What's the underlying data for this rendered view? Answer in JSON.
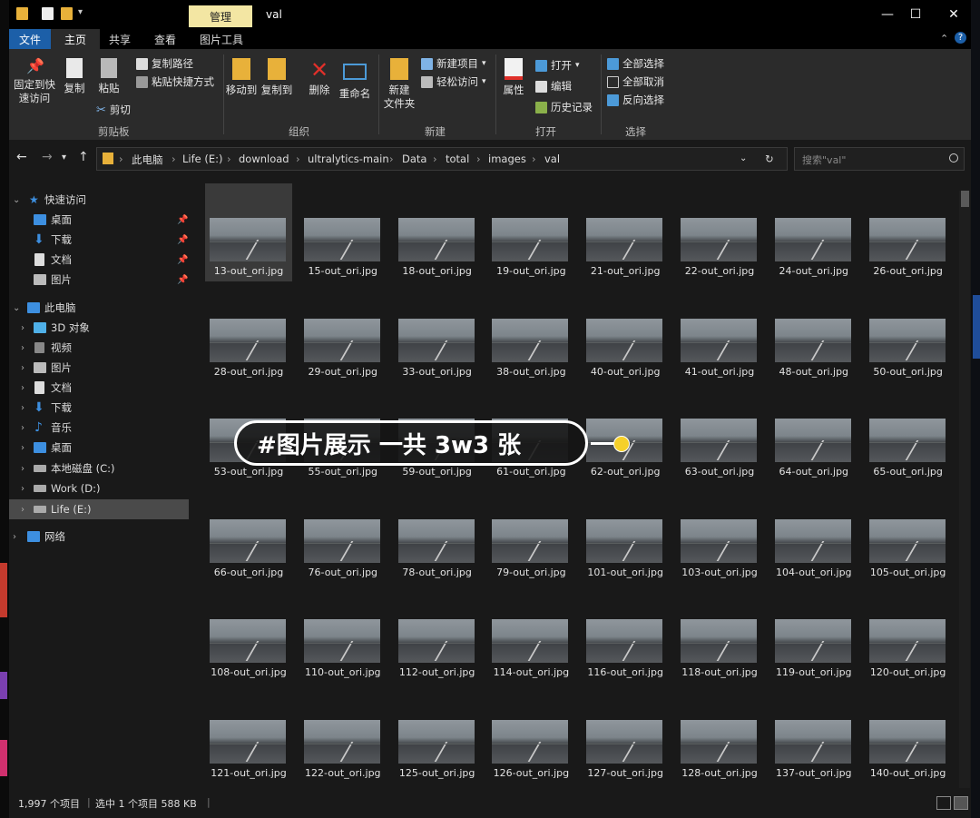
{
  "window": {
    "title": "val",
    "context_tab": "管理",
    "controls": {
      "minimize": "—",
      "maximize": "☐",
      "close": "✕"
    }
  },
  "ribbon_tabs": [
    "文件",
    "主页",
    "共享",
    "查看",
    "图片工具"
  ],
  "ribbon": {
    "clipboard": {
      "pin_quick_access": [
        "固定到快",
        "速访问"
      ],
      "copy": "复制",
      "paste": "粘贴",
      "copy_path": "复制路径",
      "paste_shortcut": "粘贴快捷方式",
      "cut": "剪切",
      "group_label": "剪贴板"
    },
    "organize": {
      "move_to": "移动到",
      "copy_to": "复制到",
      "delete": "删除",
      "rename": "重命名",
      "group_label": "组织"
    },
    "new": {
      "new_folder": [
        "新建",
        "文件夹"
      ],
      "new_item": "新建项目",
      "easy_access": "轻松访问",
      "group_label": "新建"
    },
    "open": {
      "properties": "属性",
      "open": "打开",
      "edit": "编辑",
      "history": "历史记录",
      "group_label": "打开"
    },
    "select": {
      "select_all": "全部选择",
      "select_none": "全部取消",
      "invert_selection": "反向选择",
      "group_label": "选择"
    }
  },
  "address": {
    "breadcrumbs": [
      "此电脑",
      "Life (E:)",
      "download",
      "ultralytics-main",
      "Data",
      "total",
      "images",
      "val"
    ],
    "search_placeholder": "搜索\"val\""
  },
  "nav_pane": {
    "quick_access": "快速访问",
    "quick_items": [
      "桌面",
      "下载",
      "文档",
      "图片"
    ],
    "this_pc": "此电脑",
    "pc_items": [
      "3D 对象",
      "视频",
      "图片",
      "文档",
      "下载",
      "音乐",
      "桌面",
      "本地磁盘 (C:)",
      "Work (D:)",
      "Life (E:)"
    ],
    "network": "网络"
  },
  "files": [
    "13-out_ori.jpg",
    "15-out_ori.jpg",
    "18-out_ori.jpg",
    "19-out_ori.jpg",
    "21-out_ori.jpg",
    "22-out_ori.jpg",
    "24-out_ori.jpg",
    "26-out_ori.jpg",
    "28-out_ori.jpg",
    "29-out_ori.jpg",
    "33-out_ori.jpg",
    "38-out_ori.jpg",
    "40-out_ori.jpg",
    "41-out_ori.jpg",
    "48-out_ori.jpg",
    "50-out_ori.jpg",
    "53-out_ori.jpg",
    "55-out_ori.jpg",
    "59-out_ori.jpg",
    "61-out_ori.jpg",
    "62-out_ori.jpg",
    "63-out_ori.jpg",
    "64-out_ori.jpg",
    "65-out_ori.jpg",
    "66-out_ori.jpg",
    "76-out_ori.jpg",
    "78-out_ori.jpg",
    "79-out_ori.jpg",
    "101-out_ori.jpg",
    "103-out_ori.jpg",
    "104-out_ori.jpg",
    "105-out_ori.jpg",
    "108-out_ori.jpg",
    "110-out_ori.jpg",
    "112-out_ori.jpg",
    "114-out_ori.jpg",
    "116-out_ori.jpg",
    "118-out_ori.jpg",
    "119-out_ori.jpg",
    "120-out_ori.jpg",
    "121-out_ori.jpg",
    "122-out_ori.jpg",
    "125-out_ori.jpg",
    "126-out_ori.jpg",
    "127-out_ori.jpg",
    "128-out_ori.jpg",
    "137-out_ori.jpg",
    "140-out_ori.jpg"
  ],
  "overlay_label": "#图片展示 一共 3w3 张",
  "status": {
    "item_count": "1,997 个项目",
    "selection": "选中 1 个项目  588 KB"
  },
  "colors": {
    "accent": "#1c5fa8",
    "manage_tab": "#f3e6a3",
    "overlay_dot": "#f6d02a"
  }
}
